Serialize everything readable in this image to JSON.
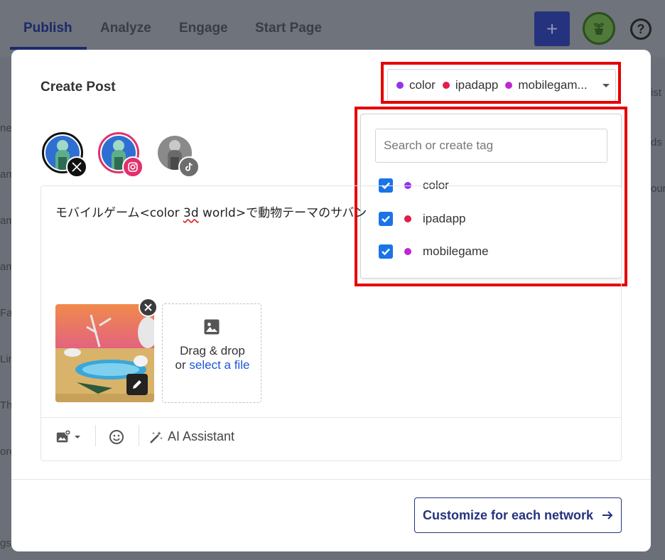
{
  "topnav": {
    "tabs": [
      "Publish",
      "Analyze",
      "Engage",
      "Start Page"
    ],
    "plus_label": "+",
    "help_label": "?"
  },
  "background_fragments": {
    "left": [
      "nel",
      "am",
      "am",
      "am",
      "Fa",
      "Lir",
      "Th",
      "ore",
      "gs"
    ],
    "right": [
      "ist",
      "ds",
      "our"
    ]
  },
  "modal": {
    "title": "Create Post",
    "tags_selected": [
      {
        "name": "color",
        "color": "#9333ea"
      },
      {
        "name": "ipadapp",
        "color": "#e11d48"
      },
      {
        "name": "mobilegam...",
        "color": "#c026d3"
      }
    ],
    "dropdown": {
      "search_placeholder": "Search or create tag",
      "options": [
        {
          "name": "color",
          "checked": true,
          "color": "#9333ea"
        },
        {
          "name": "ipadapp",
          "checked": true,
          "color": "#e11d48"
        },
        {
          "name": "mobilegame",
          "checked": true,
          "color": "#c026d3"
        }
      ]
    },
    "accounts": [
      {
        "network": "x",
        "badge_icon": "x-logo-icon"
      },
      {
        "network": "instagram",
        "badge_icon": "instagram-icon"
      },
      {
        "network": "tiktok",
        "badge_icon": "tiktok-icon"
      }
    ],
    "composer": {
      "text_before": "モバイルゲーム<color ",
      "text_misspelled": "3d",
      "text_after": " world>で動物テーマのサバン",
      "upload_line1": "Drag & drop",
      "upload_line2_prefix": "or ",
      "upload_link": "select a file",
      "ai_assistant_label": "AI Assistant"
    },
    "customize_label": "Customize for each network"
  },
  "colors": {
    "accent": "#25337e",
    "link": "#1a56db",
    "checkbox": "#1a73e8",
    "highlight": "#e50000"
  }
}
